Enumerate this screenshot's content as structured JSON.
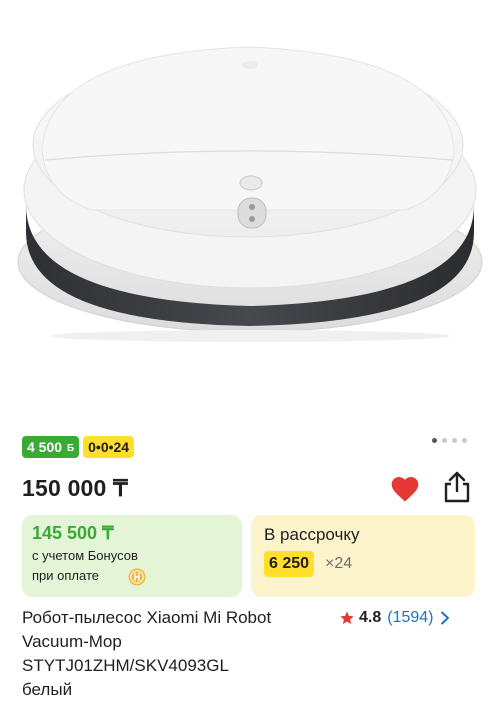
{
  "gallery": {
    "image_alt": "Робот-пылесос",
    "pages": 4,
    "active_page": 0
  },
  "badges": {
    "bonus_amount": "4 500",
    "bonus_unit": "Б",
    "installment_plan": "0•0•24"
  },
  "price": {
    "current": "150 000 ₸"
  },
  "actions": {
    "favorite_icon": "heart-icon",
    "share_icon": "share-icon"
  },
  "bonus_card": {
    "price": "145 500 ₸",
    "line1": "с учетом Бонусов",
    "line2": "при оплате",
    "coin_icon": "coin-icon"
  },
  "installment_card": {
    "label": "В рассрочку",
    "amount": "6 250",
    "months": "×24"
  },
  "product": {
    "title": "Робот-пылесос Xiaomi Mi Robot\nVacuum-Mop\nSTYTJ01ZHM/SKV4093GL\nбелый"
  },
  "rating": {
    "value": "4.8",
    "count": "(1594)"
  },
  "colors": {
    "accent_green": "#3aaa35",
    "accent_yellow": "#ffdf2b",
    "favorite_red": "#e53935",
    "link_blue": "#1a73c9"
  }
}
